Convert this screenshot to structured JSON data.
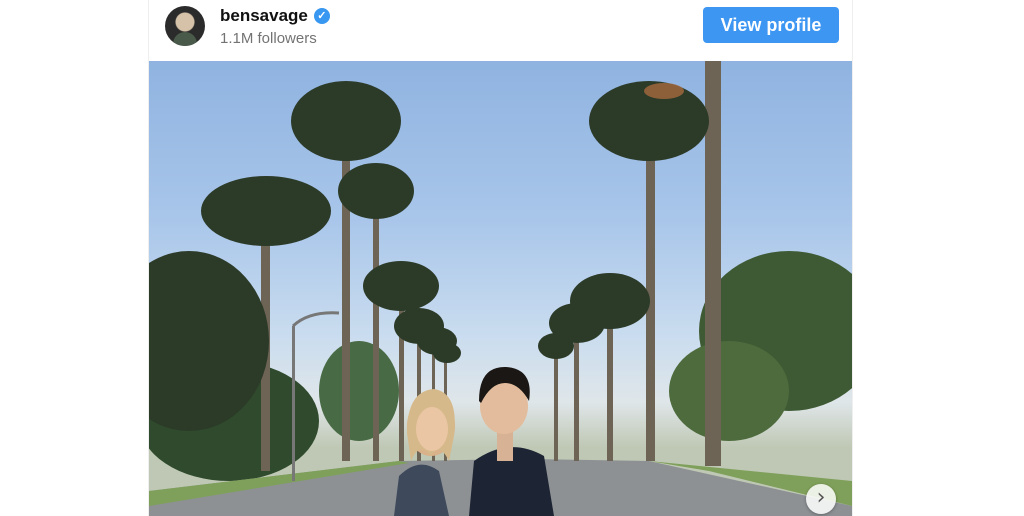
{
  "post": {
    "username": "bensavage",
    "followers": "1.1M followers",
    "view_profile_label": "View profile",
    "verified": true
  },
  "icons": {
    "verified": "verified-badge-icon",
    "next": "chevron-right-icon"
  },
  "colors": {
    "accent": "#3d96f2",
    "sky": "#a9c6ea"
  }
}
